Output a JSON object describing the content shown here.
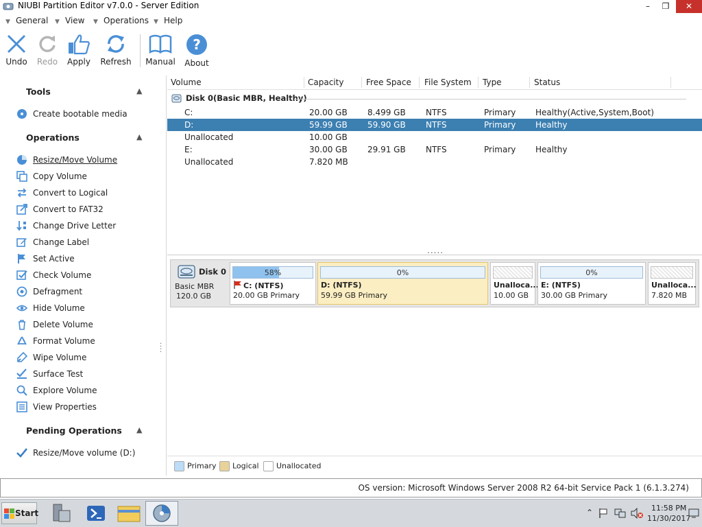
{
  "window": {
    "title": "NIUBI Partition Editor v7.0.0 - Server Edition",
    "min": "–",
    "max": "❐",
    "close": "✕"
  },
  "menu": [
    "General",
    "View",
    "Operations",
    "Help"
  ],
  "toolbar": [
    {
      "label": "Undo",
      "icon": "undo-icon",
      "enabled": true
    },
    {
      "label": "Redo",
      "icon": "redo-icon",
      "enabled": false
    },
    {
      "label": "Apply",
      "icon": "apply-icon",
      "enabled": true
    },
    {
      "label": "Refresh",
      "icon": "refresh-icon",
      "enabled": true
    },
    {
      "label": "Manual",
      "icon": "manual-icon",
      "enabled": true
    },
    {
      "label": "About",
      "icon": "about-icon",
      "enabled": true
    }
  ],
  "left": {
    "tools_title": "Tools",
    "tools": [
      {
        "label": "Create bootable media",
        "icon": "bootable-media-icon"
      }
    ],
    "operations_title": "Operations",
    "operations": [
      {
        "label": "Resize/Move Volume",
        "icon": "resize-move-icon"
      },
      {
        "label": "Copy Volume",
        "icon": "copy-icon"
      },
      {
        "label": "Convert to Logical",
        "icon": "convert-logical-icon"
      },
      {
        "label": "Convert to FAT32",
        "icon": "convert-fat32-icon"
      },
      {
        "label": "Change Drive Letter",
        "icon": "drive-letter-icon"
      },
      {
        "label": "Change Label",
        "icon": "label-icon"
      },
      {
        "label": "Set Active",
        "icon": "flag-icon"
      },
      {
        "label": "Check Volume",
        "icon": "check-icon"
      },
      {
        "label": "Defragment",
        "icon": "defragment-icon"
      },
      {
        "label": "Hide Volume",
        "icon": "eye-icon"
      },
      {
        "label": "Delete Volume",
        "icon": "delete-icon"
      },
      {
        "label": "Format Volume",
        "icon": "format-icon"
      },
      {
        "label": "Wipe Volume",
        "icon": "wipe-icon"
      },
      {
        "label": "Surface Test",
        "icon": "surface-test-icon"
      },
      {
        "label": "Explore Volume",
        "icon": "magnifier-icon"
      },
      {
        "label": "View Properties",
        "icon": "properties-icon"
      }
    ],
    "pending_title": "Pending Operations",
    "pending": [
      {
        "label": "Resize/Move volume (D:)",
        "icon": "checkmark-icon"
      }
    ]
  },
  "table": {
    "columns": [
      "Volume",
      "Capacity",
      "Free Space",
      "File System",
      "Type",
      "Status"
    ],
    "disk_label": "Disk 0(Basic MBR, Healthy)",
    "rows": [
      {
        "volume": "C:",
        "capacity": "20.00 GB",
        "free": "8.499 GB",
        "fs": "NTFS",
        "type": "Primary",
        "status": "Healthy(Active,System,Boot)",
        "selected": false
      },
      {
        "volume": "D:",
        "capacity": "59.99 GB",
        "free": "59.90 GB",
        "fs": "NTFS",
        "type": "Primary",
        "status": "Healthy",
        "selected": true
      },
      {
        "volume": "Unallocated",
        "capacity": "10.00 GB",
        "free": "",
        "fs": "",
        "type": "",
        "status": "",
        "selected": false
      },
      {
        "volume": "E:",
        "capacity": "30.00 GB",
        "free": "29.91 GB",
        "fs": "NTFS",
        "type": "Primary",
        "status": "Healthy",
        "selected": false
      },
      {
        "volume": "Unallocated",
        "capacity": "7.820 MB",
        "free": "",
        "fs": "",
        "type": "",
        "status": "",
        "selected": false
      }
    ],
    "resize_handle": "....."
  },
  "diskmap": {
    "disk_name": "Disk 0",
    "disk_type": "Basic MBR",
    "disk_size": "120.0 GB",
    "partitions": [
      {
        "name": "C: (NTFS)",
        "desc": "20.00 GB Primary",
        "used_pct": 58,
        "pct_label": "58%",
        "kind": "primary",
        "selected": false,
        "flag": true
      },
      {
        "name": "D: (NTFS)",
        "desc": "59.99 GB Primary",
        "used_pct": 0,
        "pct_label": "0%",
        "kind": "primary",
        "selected": true,
        "flag": false
      },
      {
        "name": "Unalloca...",
        "desc": "10.00 GB",
        "used_pct": 0,
        "pct_label": "",
        "kind": "unallocated",
        "selected": false,
        "flag": false
      },
      {
        "name": "E: (NTFS)",
        "desc": "30.00 GB Primary",
        "used_pct": 0,
        "pct_label": "0%",
        "kind": "primary",
        "selected": false,
        "flag": false
      },
      {
        "name": "Unalloca...",
        "desc": "7.820 MB",
        "used_pct": 0,
        "pct_label": "",
        "kind": "unallocated",
        "selected": false,
        "flag": false
      }
    ]
  },
  "legend": [
    {
      "label": "Primary",
      "color": "#bcdcf7"
    },
    {
      "label": "Logical",
      "color": "#e8d29a"
    },
    {
      "label": "Unallocated",
      "color": "#ffffff"
    }
  ],
  "status": {
    "os": "OS version: Microsoft Windows Server 2008 R2  64-bit Service Pack 1 (6.1.3.274)"
  },
  "taskbar": {
    "start": "Start",
    "time": "11:58 PM",
    "date": "11/30/2017",
    "tray_expand": "⌃"
  }
}
